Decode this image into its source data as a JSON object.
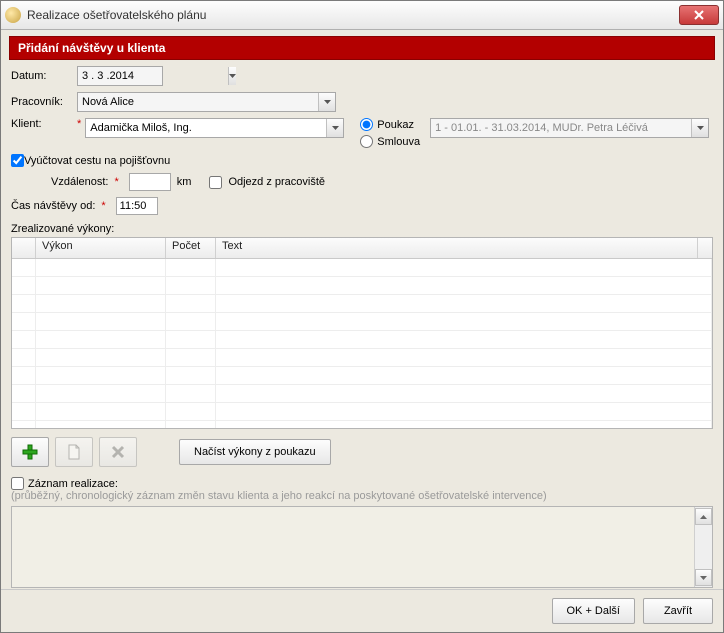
{
  "window": {
    "title": "Realizace ošetřovatelského plánu"
  },
  "panel": {
    "title": "Přidání návštěvy u klienta"
  },
  "labels": {
    "date": "Datum:",
    "worker": "Pracovník:",
    "client": "Klient:",
    "voucher": "Poukaz",
    "contract": "Smlouva",
    "bill_insurance": "Vyúčtovat cestu na pojišťovnu",
    "distance": "Vzdálenost:",
    "km": "km",
    "depart_workplace": "Odjezd z pracoviště",
    "visit_time": "Čas návštěvy od:",
    "performed_section": "Zrealizované výkony:",
    "record_heading": "Záznam realizace:",
    "record_hint": "(průběžný, chronologický záznam změn stavu klienta a jeho reakcí na poskytované ošetřovatelské intervence)"
  },
  "values": {
    "date": "3 . 3 .2014",
    "worker": "Nová Alice",
    "client": "Adamička Miloš, Ing.",
    "period": "1 - 01.01. - 31.03.2014, MUDr. Petra Léčivá",
    "bill_insurance_checked": true,
    "distance": "",
    "depart_workplace_checked": false,
    "visit_time": "11:50",
    "record_checked": false,
    "billing_mode": "voucher"
  },
  "table": {
    "columns": {
      "c1": "Výkon",
      "c2": "Počet",
      "c3": "Text"
    },
    "rows": []
  },
  "buttons": {
    "load_from_voucher": "Načíst výkony z poukazu",
    "ok_next": "OK + Další",
    "close": "Zavřít"
  }
}
